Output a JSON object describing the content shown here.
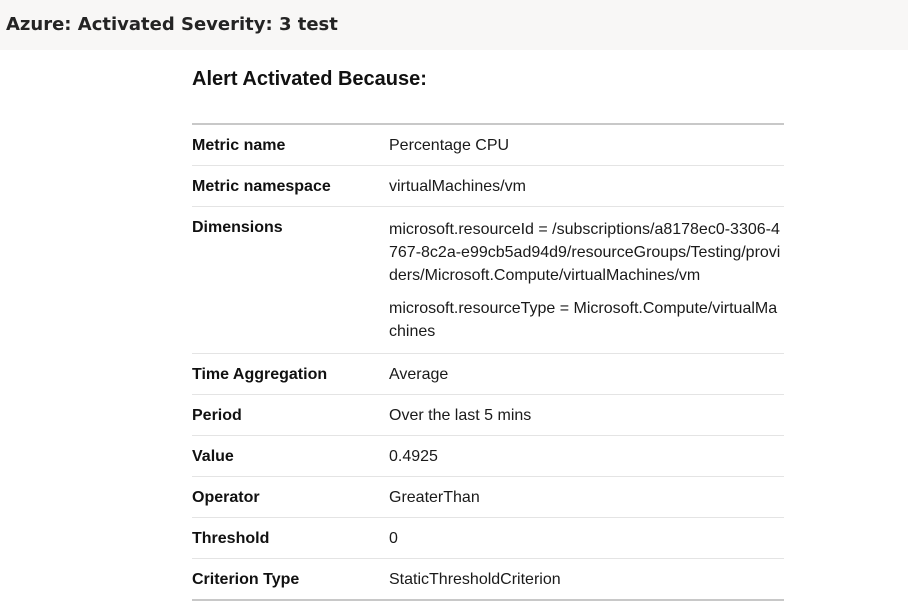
{
  "email": {
    "subject": "Azure: Activated Severity: 3 test"
  },
  "alert": {
    "title": "Alert Activated Because:",
    "rows": [
      {
        "label": "Metric name",
        "value": "Percentage CPU"
      },
      {
        "label": "Metric namespace",
        "value": "virtualMachines/vm"
      },
      {
        "label": "Dimensions",
        "values": [
          "microsoft.resourceId = /subscriptions/a8178ec0-3306-4767-8c2a-e99cb5ad94d9/resourceGroups/Testing/providers/Microsoft.Compute/virtualMachines/vm",
          "microsoft.resourceType = Microsoft.Compute/virtualMachines"
        ]
      },
      {
        "label": "Time Aggregation",
        "value": "Average"
      },
      {
        "label": "Period",
        "value": "Over the last 5 mins"
      },
      {
        "label": "Value",
        "value": "0.4925"
      },
      {
        "label": "Operator",
        "value": "GreaterThan"
      },
      {
        "label": "Threshold",
        "value": "0"
      },
      {
        "label": "Criterion Type",
        "value": "StaticThresholdCriterion"
      }
    ]
  },
  "colors": {
    "header_background": "#f8f7f6",
    "table_border": "#c8c8c8",
    "row_divider": "#e4e4e4"
  }
}
